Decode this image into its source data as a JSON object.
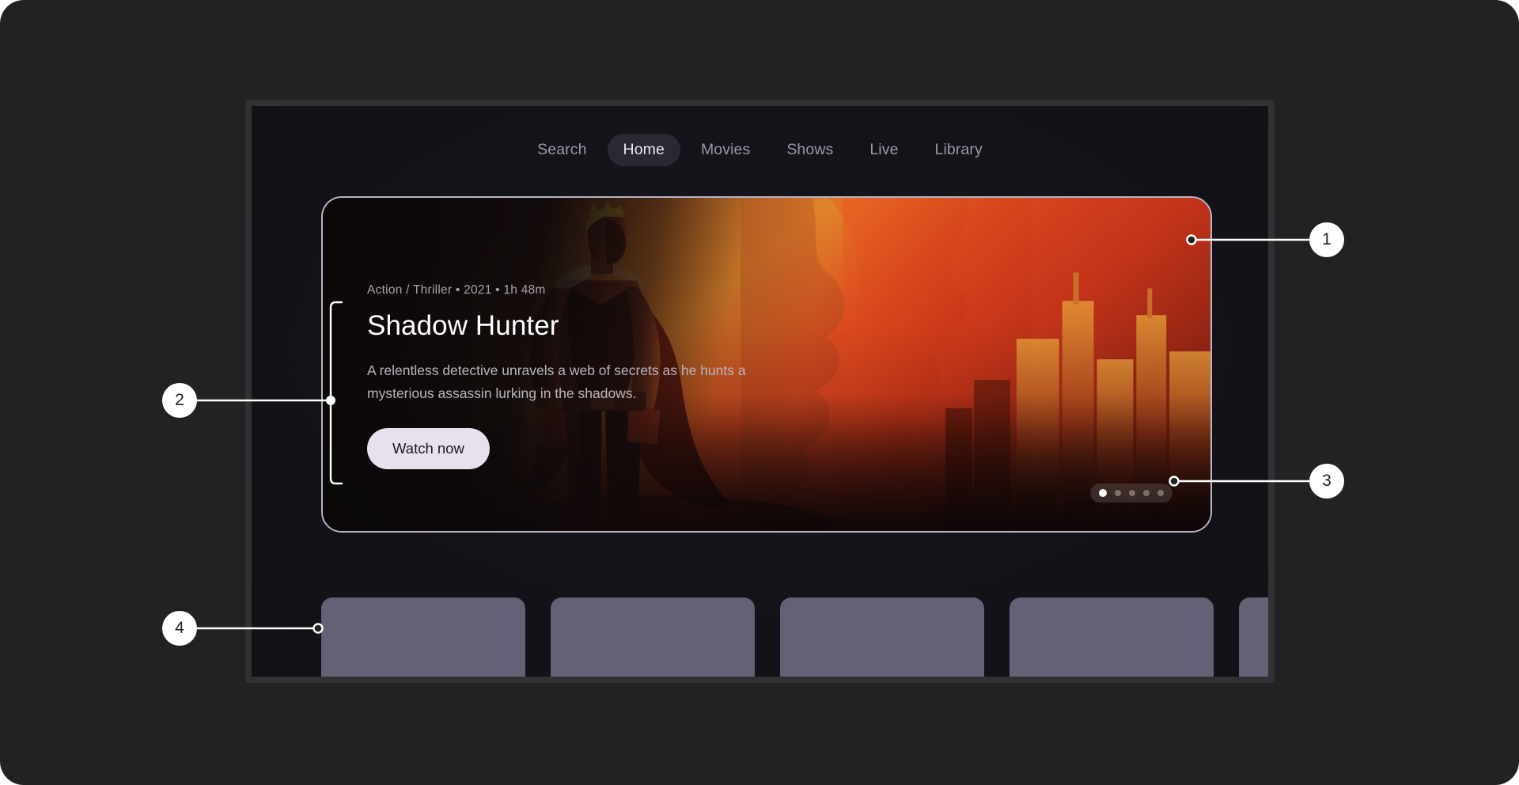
{
  "app": {
    "screen_background": "#141319",
    "frame_color": "#2f3132",
    "page_background": "#222222"
  },
  "nav": {
    "items": [
      {
        "label": "Search",
        "active": false
      },
      {
        "label": "Home",
        "active": true
      },
      {
        "label": "Movies",
        "active": false
      },
      {
        "label": "Shows",
        "active": false
      },
      {
        "label": "Live",
        "active": false
      },
      {
        "label": "Library",
        "active": false
      }
    ],
    "active_pill_color": "#2b2834",
    "active_text_color": "#e8e6ef",
    "inactive_text_color": "#9b99a6"
  },
  "hero": {
    "meta": "Action / Thriller • 2021 • 1h 48m",
    "title": "Shadow Hunter",
    "description": "A relentless detective unravels a web of secrets as he hunts a mysterious assassin lurking in the shadows.",
    "cta_label": "Watch now",
    "cta_background": "#e6e1ec",
    "cta_text_color": "#1b1820",
    "border_color": "#b7b4c4",
    "artwork_description": "Comic-style muscular hero silhouette standing before a burning orange-red city skyline"
  },
  "carousel": {
    "total_dots": 5,
    "active_index": 0,
    "active_dot_color": "#ffffff",
    "inactive_dot_color": "rgba(255,255,255,0.33)"
  },
  "rail": {
    "thumbnail_color": "#646075",
    "thumbnails": [
      {
        "id": "thumb-1"
      },
      {
        "id": "thumb-2"
      },
      {
        "id": "thumb-3"
      },
      {
        "id": "thumb-4"
      },
      {
        "id": "thumb-5"
      }
    ]
  },
  "annotations": {
    "marker_fill": "#ffffff",
    "marker_text_color": "#222222",
    "line_color": "#ffffff",
    "items": [
      {
        "number": "1",
        "target": "hero-card"
      },
      {
        "number": "2",
        "target": "hero-text-block"
      },
      {
        "number": "3",
        "target": "carousel-dots"
      },
      {
        "number": "4",
        "target": "thumbnail-rail"
      }
    ]
  }
}
